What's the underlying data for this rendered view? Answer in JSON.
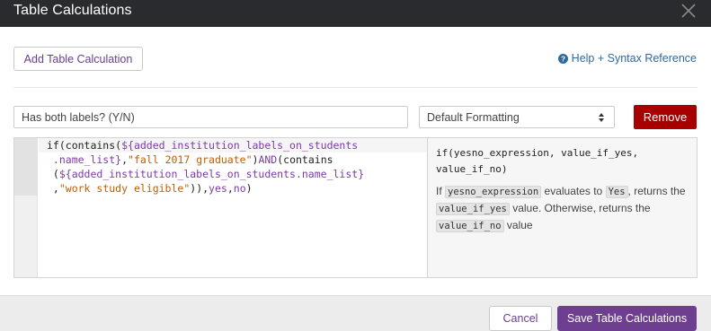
{
  "dialog": {
    "title": "Table Calculations",
    "close_icon": "close-icon"
  },
  "toolbar": {
    "add_label": "Add Table Calculation",
    "help_icon": "question-circle-icon",
    "help_label": "Help + Syntax Reference"
  },
  "calc": {
    "name_value": "Has both labels? (Y/N)",
    "format_value": "Default Formatting",
    "remove_label": "Remove"
  },
  "editor": {
    "lines": [
      [
        {
          "t": "if(contains(",
          "c": ""
        },
        {
          "t": "${added_institution_labels_on_students",
          "c": "var"
        }
      ],
      [
        {
          "t": " .name_list}",
          "c": "var"
        },
        {
          "t": ",",
          "c": ""
        },
        {
          "t": "\"fall 2017 graduate\"",
          "c": "str"
        },
        {
          "t": ")",
          "c": ""
        },
        {
          "t": "AND",
          "c": "kw"
        },
        {
          "t": "(contains",
          "c": ""
        }
      ],
      [
        {
          "t": " (",
          "c": ""
        },
        {
          "t": "${added_institution_labels_on_students.name_list}",
          "c": "var"
        }
      ],
      [
        {
          "t": " ,",
          "c": ""
        },
        {
          "t": "\"work study eligible\"",
          "c": "str"
        },
        {
          "t": ")),",
          "c": ""
        },
        {
          "t": "yes",
          "c": "kw"
        },
        {
          "t": ",",
          "c": ""
        },
        {
          "t": "no",
          "c": "kw"
        },
        {
          "t": ")",
          "c": ""
        }
      ]
    ]
  },
  "docs": {
    "signature_line1": "if(yesno_expression, value_if_yes,",
    "signature_line2": "value_if_no)",
    "desc_if": "If",
    "desc_code1": "yesno_expression",
    "desc_evaluates": "evaluates to",
    "desc_code2": "Yes",
    "desc_returns": ", returns the",
    "desc_code3": "value_if_yes",
    "desc_otherwise": "value. Otherwise, returns the",
    "desc_code4": "value_if_no",
    "desc_value": "value"
  },
  "footer": {
    "cancel_label": "Cancel",
    "save_label": "Save Table Calculations"
  },
  "colors": {
    "header_bg": "#2a2b2e",
    "accent": "#6e3f91",
    "link": "#30689b",
    "danger": "#a80000",
    "code_var": "#7b3aa8",
    "code_str": "#c25c00"
  }
}
